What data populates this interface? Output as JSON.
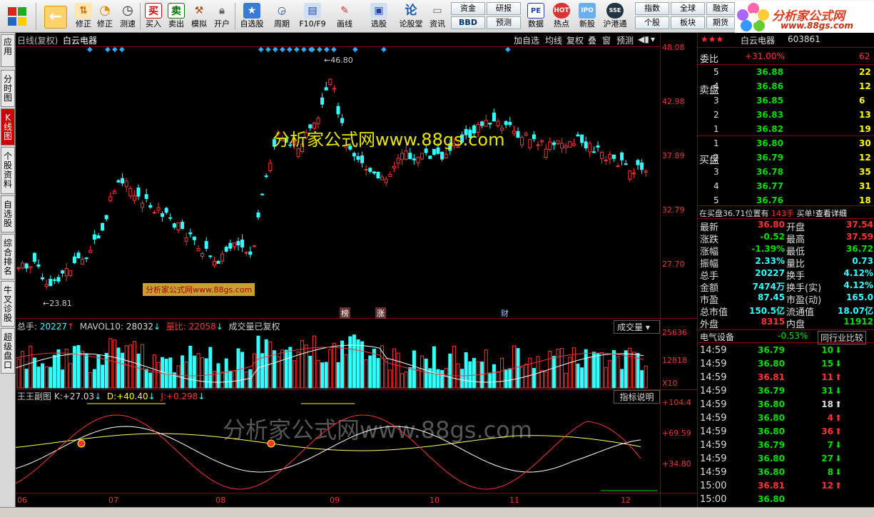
{
  "toolbar": {
    "buttons": [
      {
        "id": "back",
        "label": "",
        "icon": "back-arrow-icon"
      },
      {
        "id": "modify",
        "label": "修正",
        "icon": "modify-icon"
      },
      {
        "id": "test",
        "label": "测速",
        "icon": "clock-icon"
      },
      {
        "id": "buy",
        "label": "买入",
        "icon": "buy-icon"
      },
      {
        "id": "sell",
        "label": "卖出",
        "icon": "sell-icon"
      },
      {
        "id": "simulate",
        "label": "模拟",
        "icon": "hammer-icon"
      },
      {
        "id": "open",
        "label": "开户",
        "icon": "lock-icon"
      },
      {
        "id": "watchlist",
        "label": "自选股",
        "icon": "star-icon"
      },
      {
        "id": "period",
        "label": "周期",
        "icon": "period-icon"
      },
      {
        "id": "f10",
        "label": "F10/F9",
        "icon": "f10-icon"
      },
      {
        "id": "draw",
        "label": "画线",
        "icon": "pen-icon"
      },
      {
        "id": "select",
        "label": "选股",
        "icon": "monitor-icon"
      },
      {
        "id": "forum",
        "label": "论股堂",
        "icon": "forum-icon"
      },
      {
        "id": "info",
        "label": "资讯",
        "icon": "document-icon"
      },
      {
        "id": "data",
        "label": "数据",
        "icon": "pe-icon"
      },
      {
        "id": "hot",
        "label": "热点",
        "icon": "hot-icon"
      },
      {
        "id": "newstock",
        "label": "新股",
        "icon": "ipo-icon"
      },
      {
        "id": "hk",
        "label": "沪港通",
        "icon": "hk-icon"
      }
    ],
    "small_buttons": [
      "资金",
      "研报",
      "BBD",
      "预测",
      "指数",
      "全球",
      "板块",
      "个股",
      "期货",
      "融资"
    ]
  },
  "logo": {
    "line1": "分析家公式网",
    "line2": "www.88gs.com"
  },
  "sidenav": [
    "应用",
    "分时图",
    "K线图",
    "个股资料",
    "自选股",
    "综合排名",
    "牛叉诊股",
    "超级盘口"
  ],
  "chart": {
    "title": "日线(复权)",
    "stock": "白云电器",
    "top_buttons": [
      "加自选",
      "均线",
      "复权",
      "叠",
      "窗",
      "预测"
    ],
    "price_labels": [
      "48.08",
      "42.98",
      "37.89",
      "32.79",
      "27.70"
    ],
    "high_label": "46.80",
    "low_label": "23.81",
    "watermark": "分析家公式网www.88gs.com",
    "watermark2": "分析家公式网www.88gs.com",
    "watermark_small": "分析家公式网www.88gs.com",
    "events": [
      "榜",
      "涨",
      "财"
    ],
    "volume": {
      "total_label": "总手:",
      "total": "20227",
      "mavol_label": "MAVOL10:",
      "mavol": "28032",
      "ratio_label": "量比:",
      "ratio": "22058",
      "note": "成交量已复权",
      "dropdown": "成交量",
      "labels": [
        "25636",
        "12818"
      ],
      "unit": "X10"
    },
    "indicator": {
      "name": "王王副图",
      "k_label": "K:",
      "k": "+27.03",
      "d_label": "D:",
      "d": "+40.40",
      "j_label": "J:",
      "j": "+0.298",
      "help": "指标说明",
      "labels": [
        "+104.4",
        "+69.59",
        "+34.80"
      ]
    },
    "x_labels": [
      "06",
      "07",
      "08",
      "09",
      "10",
      "11",
      "12"
    ]
  },
  "quote": {
    "name_header": "白云电器",
    "code": "603861",
    "weibi_label": "委比",
    "weibi": "+31.00%",
    "weibi_extra": "62",
    "sell_side": "卖盘",
    "buy_side": "买盘",
    "asks": [
      {
        "n": "5",
        "p": "36.88",
        "v": "22"
      },
      {
        "n": "4",
        "p": "36.86",
        "v": "12"
      },
      {
        "n": "3",
        "p": "36.85",
        "v": "6"
      },
      {
        "n": "2",
        "p": "36.83",
        "v": "13"
      },
      {
        "n": "1",
        "p": "36.82",
        "v": "19"
      }
    ],
    "bids": [
      {
        "n": "1",
        "p": "36.80",
        "v": "30"
      },
      {
        "n": "2",
        "p": "36.79",
        "v": "12"
      },
      {
        "n": "3",
        "p": "36.78",
        "v": "35"
      },
      {
        "n": "4",
        "p": "36.77",
        "v": "31"
      },
      {
        "n": "5",
        "p": "36.76",
        "v": "18"
      }
    ],
    "notice": "在买盘36.71位置有",
    "notice_qty": "143手",
    "notice_tail": "买单!",
    "notice_link": "查看详细",
    "stats": [
      {
        "l1": "最新",
        "v1": "36.80",
        "l2": "开盘",
        "v2": "37.54"
      },
      {
        "l1": "涨跌",
        "v1": "-0.52",
        "l2": "最高",
        "v2": "37.59"
      },
      {
        "l1": "涨幅",
        "v1": "-1.39%",
        "l2": "最低",
        "v2": "36.72"
      },
      {
        "l1": "振幅",
        "v1": "2.33%",
        "l2": "量比",
        "v2": "0.73"
      },
      {
        "l1": "总手",
        "v1": "20227",
        "l2": "换手",
        "v2": "4.12%"
      },
      {
        "l1": "金额",
        "v1": "7474万",
        "l2": "换手(实)",
        "v2": "4.12%"
      },
      {
        "l1": "市盈",
        "v1": "87.45",
        "l2": "市盈(动)",
        "v2": "165.0"
      },
      {
        "l1": "总市值",
        "v1": "150.5亿",
        "l2": "流通值",
        "v2": "18.07亿"
      },
      {
        "l1": "外盘",
        "v1": "8315",
        "l2": "内盘",
        "v2": "11912"
      }
    ],
    "sector": "电气设备",
    "sector_chg": "-0.53%",
    "compare": "同行业比较",
    "ticks": [
      {
        "t": "14:59",
        "p": "36.79",
        "v": "10",
        "d": "down"
      },
      {
        "t": "14:59",
        "p": "36.80",
        "v": "15",
        "d": "down"
      },
      {
        "t": "14:59",
        "p": "36.81",
        "v": "11",
        "d": "up"
      },
      {
        "t": "14:59",
        "p": "36.79",
        "v": "31",
        "d": "down"
      },
      {
        "t": "14:59",
        "p": "36.80",
        "v": "18",
        "d": "upw"
      },
      {
        "t": "14:59",
        "p": "36.80",
        "v": "4",
        "d": "up"
      },
      {
        "t": "14:59",
        "p": "36.80",
        "v": "36",
        "d": "up"
      },
      {
        "t": "14:59",
        "p": "36.79",
        "v": "7",
        "d": "down"
      },
      {
        "t": "14:59",
        "p": "36.80",
        "v": "27",
        "d": "down"
      },
      {
        "t": "14:59",
        "p": "36.80",
        "v": "8",
        "d": "down"
      },
      {
        "t": "15:00",
        "p": "36.81",
        "v": "12",
        "d": "up"
      },
      {
        "t": "15:00",
        "p": "36.80",
        "v": "",
        "d": ""
      }
    ]
  },
  "colors": {
    "up": "#ff3333",
    "down": "#33ffff",
    "price_red": "#ff3333",
    "price_green": "#00e000"
  }
}
